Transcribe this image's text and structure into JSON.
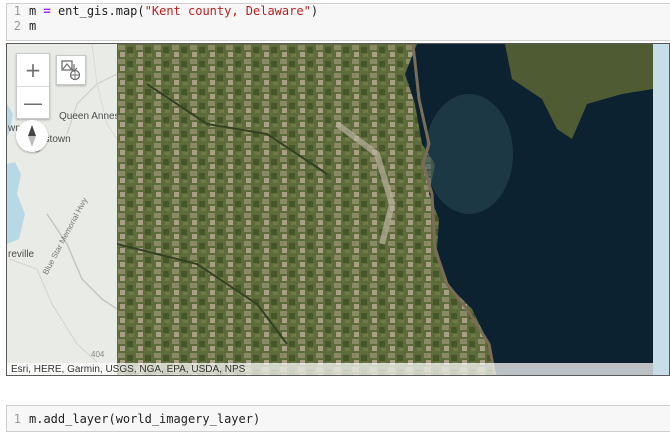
{
  "cells": [
    {
      "lines": [
        {
          "number": "1",
          "var": "m",
          "op": "=",
          "call": "ent_gis.map(",
          "arg": "\"Kent county, Delaware\"",
          "close": ")"
        },
        {
          "number": "2",
          "var": "m"
        }
      ]
    },
    {
      "lines": [
        {
          "number": "1",
          "code": "m.add_layer(world_imagery_layer)"
        }
      ]
    }
  ],
  "map": {
    "zoom_in_symbol": "+",
    "zoom_out_symbol": "—",
    "icons": {
      "zoom_in": "plus-icon",
      "zoom_out": "minus-icon",
      "layers": "layers-icon",
      "compass": "compass-icon"
    },
    "basemap_labels": [
      "Queen Annes",
      "wn",
      "gstown",
      "Blue Star Memorial Hwy",
      "reville",
      "404"
    ],
    "attribution": "Esri, HERE, Garmin, USGS, NGA, EPA, USDA, NPS",
    "colors": {
      "basemap": "#e9ece6",
      "water_basemap": "#b9d8e6",
      "land_imagery": "#5d6a3a",
      "water_imagery": "#0d2231",
      "right_strip": "#c7dde8"
    }
  }
}
